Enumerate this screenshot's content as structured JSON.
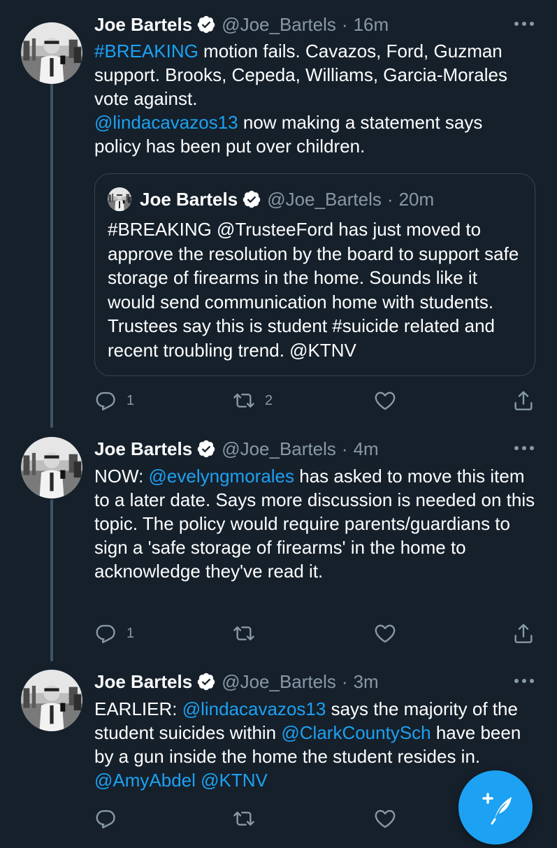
{
  "tweets": [
    {
      "name": "Joe Bartels",
      "handle": "@Joe_Bartels",
      "dot": "·",
      "time": "16m",
      "body": [
        {
          "text": "#BREAKING",
          "link": true
        },
        {
          "text": " motion fails. Cavazos, Ford, Guzman support. Brooks, Cepeda, Williams, Garcia-Morales vote against.",
          "link": false
        },
        {
          "text": "\n",
          "link": false
        },
        {
          "text": "@lindacavazos13",
          "link": true
        },
        {
          "text": " now making a statement says policy has been put over children.",
          "link": false
        }
      ],
      "quote": {
        "name": "Joe Bartels",
        "handle": "@Joe_Bartels",
        "dot": "·",
        "time": "20m",
        "body": "#BREAKING @TrusteeFord has just moved to approve the resolution by the board to support safe storage of firearms in the home. Sounds like it would send communication home with students. Trustees say this is student #suicide related and recent troubling trend. @KTNV"
      },
      "reply_count": "1",
      "retweet_count": "2",
      "like_count": ""
    },
    {
      "name": "Joe Bartels",
      "handle": "@Joe_Bartels",
      "dot": "·",
      "time": "4m",
      "body": [
        {
          "text": "NOW: ",
          "link": false
        },
        {
          "text": "@evelyngmorales",
          "link": true
        },
        {
          "text": " has asked to move this item to a later date. Says more discussion is needed on this topic. The policy would require parents/guardians to sign a 'safe storage of firearms' in the home to acknowledge they've read it.",
          "link": false
        }
      ],
      "reply_count": "1",
      "retweet_count": "",
      "like_count": ""
    },
    {
      "name": "Joe Bartels",
      "handle": "@Joe_Bartels",
      "dot": "·",
      "time": "3m",
      "body": [
        {
          "text": "EARLIER: ",
          "link": false
        },
        {
          "text": "@lindacavazos13",
          "link": true
        },
        {
          "text": " says the majority of the student suicides within ",
          "link": false
        },
        {
          "text": "@ClarkCountySch",
          "link": true
        },
        {
          "text": " have been by a gun inside the home the student resides in. ",
          "link": false
        },
        {
          "text": "@AmyAbdel",
          "link": true
        },
        {
          "text": " ",
          "link": false
        },
        {
          "text": "@KTNV",
          "link": true
        }
      ],
      "reply_count": "",
      "retweet_count": "",
      "like_count": ""
    }
  ],
  "colors": {
    "background": "#15202b",
    "link": "#1da1f2",
    "secondary_text": "#8899a6",
    "thread_line": "#3d5466",
    "border": "#38444d"
  },
  "icons": {
    "verified": "verified-badge-icon",
    "more": "more-options-icon",
    "reply": "reply-icon",
    "retweet": "retweet-icon",
    "like": "heart-icon",
    "share": "share-icon",
    "compose": "compose-tweet-icon"
  }
}
